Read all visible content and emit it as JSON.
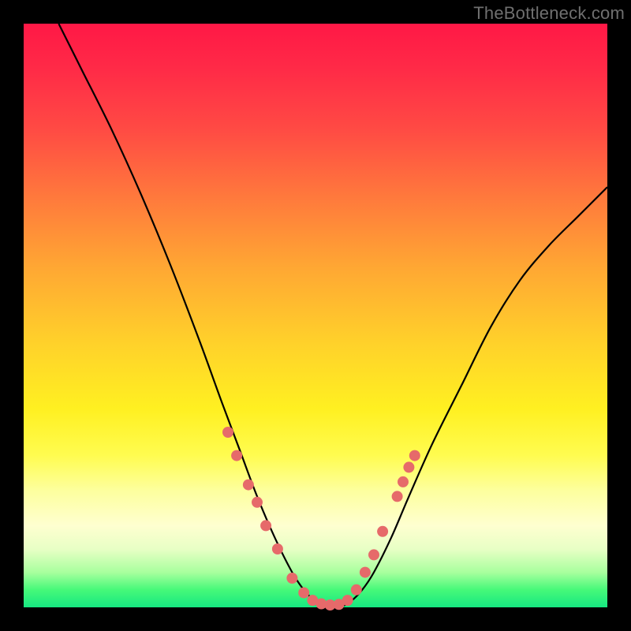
{
  "watermark": "TheBottleneck.com",
  "chart_data": {
    "type": "line",
    "title": "",
    "xlabel": "",
    "ylabel": "",
    "xlim": [
      0,
      100
    ],
    "ylim": [
      0,
      100
    ],
    "series": [
      {
        "name": "curve",
        "x": [
          6,
          10,
          15,
          20,
          25,
          30,
          34,
          37,
          40,
          43,
          46,
          48,
          50,
          52,
          54,
          56,
          58,
          60,
          63,
          66,
          70,
          75,
          80,
          85,
          90,
          95,
          100
        ],
        "y": [
          100,
          92,
          82,
          71,
          59,
          46,
          35,
          27,
          19,
          12,
          6,
          3,
          1,
          0,
          0,
          1,
          3,
          6,
          12,
          19,
          28,
          38,
          48,
          56,
          62,
          67,
          72
        ]
      }
    ],
    "markers": {
      "name": "dots",
      "color": "#e66a6a",
      "radius": 7,
      "points": [
        {
          "x": 35,
          "y": 30
        },
        {
          "x": 36.5,
          "y": 26
        },
        {
          "x": 38.5,
          "y": 21
        },
        {
          "x": 40,
          "y": 18
        },
        {
          "x": 41.5,
          "y": 14
        },
        {
          "x": 43.5,
          "y": 10
        },
        {
          "x": 46,
          "y": 5
        },
        {
          "x": 48,
          "y": 2.5
        },
        {
          "x": 49.5,
          "y": 1.2
        },
        {
          "x": 51,
          "y": 0.6
        },
        {
          "x": 52.5,
          "y": 0.4
        },
        {
          "x": 54,
          "y": 0.5
        },
        {
          "x": 55.5,
          "y": 1.2
        },
        {
          "x": 57,
          "y": 3
        },
        {
          "x": 58.5,
          "y": 6
        },
        {
          "x": 60,
          "y": 9
        },
        {
          "x": 61.5,
          "y": 13
        },
        {
          "x": 64,
          "y": 19
        },
        {
          "x": 65,
          "y": 21.5
        },
        {
          "x": 66,
          "y": 24
        },
        {
          "x": 67,
          "y": 26
        }
      ]
    },
    "gradient_stops": [
      {
        "pct": 0,
        "color": "#ff1846"
      },
      {
        "pct": 30,
        "color": "#ff7a3c"
      },
      {
        "pct": 55,
        "color": "#ffd22a"
      },
      {
        "pct": 80,
        "color": "#fdff9e"
      },
      {
        "pct": 100,
        "color": "#16e781"
      }
    ]
  }
}
